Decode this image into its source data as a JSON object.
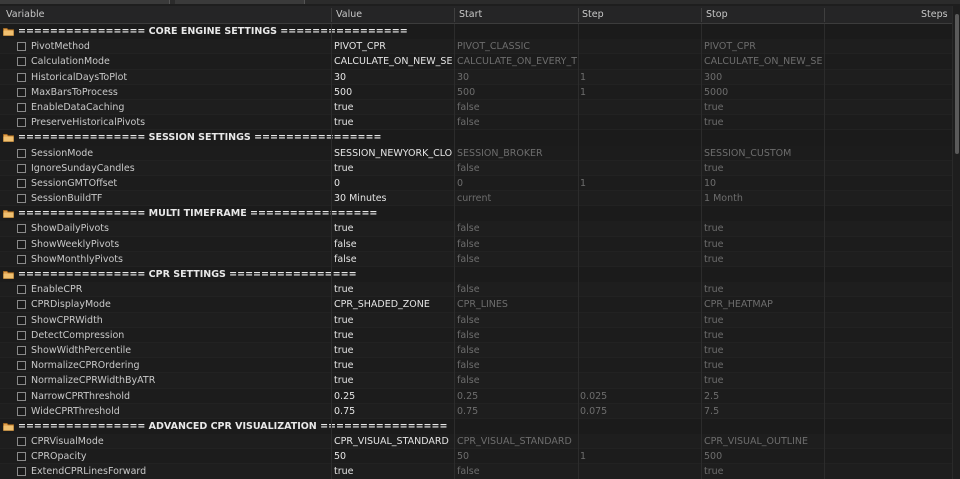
{
  "header": {
    "variable": "Variable",
    "value": "Value",
    "start": "Start",
    "step": "Step",
    "stop": "Stop",
    "steps": "Steps"
  },
  "groups": [
    {
      "title": "================ CORE ENGINE SETTINGS ================",
      "rows": [
        {
          "name": "PivotMethod",
          "value": "PIVOT_CPR",
          "start": "PIVOT_CLASSIC",
          "step": "",
          "stop": "PIVOT_CPR"
        },
        {
          "name": "CalculationMode",
          "value": "CALCULATE_ON_NEW_SESS...",
          "start": "CALCULATE_ON_EVERY_TICK",
          "step": "",
          "stop": "CALCULATE_ON_NEW_SESS..."
        },
        {
          "name": "HistoricalDaysToPlot",
          "value": "30",
          "start": "30",
          "step": "1",
          "stop": "300"
        },
        {
          "name": "MaxBarsToProcess",
          "value": "500",
          "start": "500",
          "step": "1",
          "stop": "5000"
        },
        {
          "name": "EnableDataCaching",
          "value": "true",
          "start": "false",
          "step": "",
          "stop": "true"
        },
        {
          "name": "PreserveHistoricalPivots",
          "value": "true",
          "start": "false",
          "step": "",
          "stop": "true"
        }
      ]
    },
    {
      "title": "================ SESSION SETTINGS ================",
      "rows": [
        {
          "name": "SessionMode",
          "value": "SESSION_NEWYORK_CLOSE",
          "start": "SESSION_BROKER",
          "step": "",
          "stop": "SESSION_CUSTOM"
        },
        {
          "name": "IgnoreSundayCandles",
          "value": "true",
          "start": "false",
          "step": "",
          "stop": "true"
        },
        {
          "name": "SessionGMTOffset",
          "value": "0",
          "start": "0",
          "step": "1",
          "stop": "10"
        },
        {
          "name": "SessionBuildTF",
          "value": "30 Minutes",
          "start": "current",
          "step": "",
          "stop": "1 Month"
        }
      ]
    },
    {
      "title": "================ MULTI TIMEFRAME ================",
      "rows": [
        {
          "name": "ShowDailyPivots",
          "value": "true",
          "start": "false",
          "step": "",
          "stop": "true"
        },
        {
          "name": "ShowWeeklyPivots",
          "value": "false",
          "start": "false",
          "step": "",
          "stop": "true"
        },
        {
          "name": "ShowMonthlyPivots",
          "value": "false",
          "start": "false",
          "step": "",
          "stop": "true"
        }
      ]
    },
    {
      "title": "================ CPR SETTINGS ================",
      "rows": [
        {
          "name": "EnableCPR",
          "value": "true",
          "start": "false",
          "step": "",
          "stop": "true"
        },
        {
          "name": "CPRDisplayMode",
          "value": "CPR_SHADED_ZONE",
          "start": "CPR_LINES",
          "step": "",
          "stop": "CPR_HEATMAP"
        },
        {
          "name": "ShowCPRWidth",
          "value": "true",
          "start": "false",
          "step": "",
          "stop": "true"
        },
        {
          "name": "DetectCompression",
          "value": "true",
          "start": "false",
          "step": "",
          "stop": "true"
        },
        {
          "name": "ShowWidthPercentile",
          "value": "true",
          "start": "false",
          "step": "",
          "stop": "true"
        },
        {
          "name": "NormalizeCPROrdering",
          "value": "true",
          "start": "false",
          "step": "",
          "stop": "true"
        },
        {
          "name": "NormalizeCPRWidthByATR",
          "value": "true",
          "start": "false",
          "step": "",
          "stop": "true"
        },
        {
          "name": "NarrowCPRThreshold",
          "value": "0.25",
          "start": "0.25",
          "step": "0.025",
          "stop": "2.5"
        },
        {
          "name": "WideCPRThreshold",
          "value": "0.75",
          "start": "0.75",
          "step": "0.075",
          "stop": "7.5"
        }
      ]
    },
    {
      "title": "================ ADVANCED CPR VISUALIZATION ================",
      "rows": [
        {
          "name": "CPRVisualMode",
          "value": "CPR_VISUAL_STANDARD",
          "start": "CPR_VISUAL_STANDARD",
          "step": "",
          "stop": "CPR_VISUAL_OUTLINE"
        },
        {
          "name": "CPROpacity",
          "value": "50",
          "start": "50",
          "step": "1",
          "stop": "500"
        },
        {
          "name": "ExtendCPRLinesForward",
          "value": "true",
          "start": "false",
          "step": "",
          "stop": "true"
        }
      ]
    }
  ]
}
